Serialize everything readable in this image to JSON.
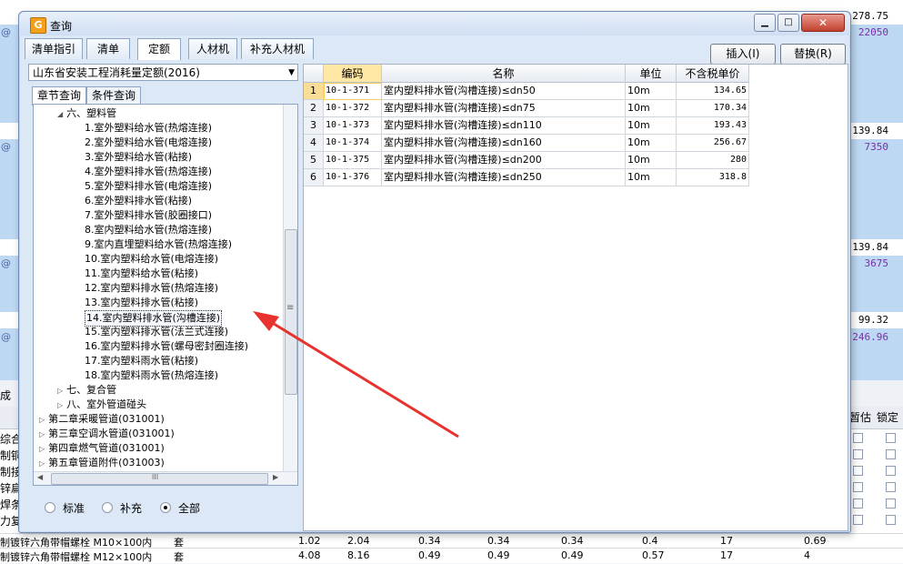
{
  "background": {
    "right_values": [
      {
        "text": "278.75",
        "color": "black"
      },
      {
        "text": "22050",
        "color": "purple"
      },
      {
        "text": "139.84",
        "color": "black"
      },
      {
        "text": "7350",
        "color": "purple"
      },
      {
        "text": "139.84",
        "color": "black"
      },
      {
        "text": "3675",
        "color": "purple"
      },
      {
        "text": "99.32",
        "color": "black"
      },
      {
        "text": "246.96",
        "color": "purple"
      }
    ],
    "at_symbol": "@",
    "lower_header_left": "成",
    "lower_col_headers": [
      "暂估",
      "锁定"
    ],
    "left_snippets": [
      "综合工",
      "制铜线",
      "制接线",
      "锌扁",
      "焊条",
      "力复"
    ],
    "bottom_rows": [
      {
        "name": "制镀锌六角带帽螺栓 M10×100内",
        "unit": "套",
        "v1": "1.02",
        "v2": "2.04",
        "v3": "0.34",
        "v4": "0.34",
        "v5": "0.34",
        "v6": "0.4",
        "v7": "17",
        "v8": "0.69"
      },
      {
        "name": "制镀锌六角带帽螺栓 M12×100内",
        "unit": "套",
        "v1": "4.08",
        "v2": "8.16",
        "v3": "0.49",
        "v4": "0.49",
        "v5": "0.49",
        "v6": "0.57",
        "v7": "17",
        "v8": "4"
      }
    ]
  },
  "dialog": {
    "title": "查询",
    "controls": {
      "minimize": "▁",
      "maximize": "□",
      "close": "✕"
    },
    "tabs": [
      "清单指引",
      "清单",
      "定额",
      "人材机",
      "补充人材机"
    ],
    "active_tab": "定额",
    "insert_label": "插入(I)",
    "replace_label": "替换(R)",
    "quota_lib": "山东省安装工程消耗量定额(2016)",
    "subtabs": [
      "章节查询",
      "条件查询"
    ],
    "tree": [
      {
        "label": "六、塑料管",
        "level": 2,
        "twisty": "◢"
      },
      {
        "label": "1.室外塑料给水管(热熔连接)",
        "level": 3
      },
      {
        "label": "2.室外塑料给水管(电熔连接)",
        "level": 3
      },
      {
        "label": "3.室外塑料给水管(粘接)",
        "level": 3
      },
      {
        "label": "4.室外塑料排水管(热熔连接)",
        "level": 3
      },
      {
        "label": "5.室外塑料排水管(电熔连接)",
        "level": 3
      },
      {
        "label": "6.室外塑料排水管(粘接)",
        "level": 3
      },
      {
        "label": "7.室外塑料排水管(胶圈接口)",
        "level": 3
      },
      {
        "label": "8.室内塑料给水管(热熔连接)",
        "level": 3
      },
      {
        "label": "9.室内直埋塑料给水管(热熔连接)",
        "level": 3
      },
      {
        "label": "10.室内塑料给水管(电熔连接)",
        "level": 3
      },
      {
        "label": "11.室内塑料给水管(粘接)",
        "level": 3
      },
      {
        "label": "12.室内塑料排水管(热熔连接)",
        "level": 3
      },
      {
        "label": "13.室内塑料排水管(粘接)",
        "level": 3
      },
      {
        "label": "14.室内塑料排水管(沟槽连接)",
        "level": 3,
        "selected": true
      },
      {
        "label": "15.室内塑料排水管(法兰式连接)",
        "level": 3
      },
      {
        "label": "16.室内塑料排水管(螺母密封圈连接)",
        "level": 3
      },
      {
        "label": "17.室内塑料雨水管(粘接)",
        "level": 3
      },
      {
        "label": "18.室内塑料雨水管(热熔连接)",
        "level": 3
      },
      {
        "label": "七、复合管",
        "level": 2,
        "twisty": "▷"
      },
      {
        "label": "八、室外管道碰头",
        "level": 2,
        "twisty": "▷"
      },
      {
        "label": "第二章采暖管道(031001)",
        "level": 1,
        "twisty": "▷"
      },
      {
        "label": "第三章空调水管道(031001)",
        "level": 1,
        "twisty": "▷"
      },
      {
        "label": "第四章燃气管道(031001)",
        "level": 1,
        "twisty": "▷"
      },
      {
        "label": "第五章管道附件(031003)",
        "level": 1,
        "twisty": "▷"
      }
    ],
    "scroll_grip": "≡",
    "hscroll_grip": "III",
    "hscroll_left": "◀",
    "hscroll_right": "▶",
    "radios": [
      {
        "label": "标准",
        "checked": false
      },
      {
        "label": "补充",
        "checked": false
      },
      {
        "label": "全部",
        "checked": true
      }
    ],
    "grid": {
      "headers": [
        "编码",
        "名称",
        "单位",
        "不含税单价"
      ],
      "rows": [
        {
          "n": "1",
          "code": "10-1-371",
          "name": "室内塑料排水管(沟槽连接)≤dn50",
          "unit": "10m",
          "price": "134.65"
        },
        {
          "n": "2",
          "code": "10-1-372",
          "name": "室内塑料排水管(沟槽连接)≤dn75",
          "unit": "10m",
          "price": "170.34"
        },
        {
          "n": "3",
          "code": "10-1-373",
          "name": "室内塑料排水管(沟槽连接)≤dn110",
          "unit": "10m",
          "price": "193.43"
        },
        {
          "n": "4",
          "code": "10-1-374",
          "name": "室内塑料排水管(沟槽连接)≤dn160",
          "unit": "10m",
          "price": "256.67"
        },
        {
          "n": "5",
          "code": "10-1-375",
          "name": "室内塑料排水管(沟槽连接)≤dn200",
          "unit": "10m",
          "price": "280"
        },
        {
          "n": "6",
          "code": "10-1-376",
          "name": "室内塑料排水管(沟槽连接)≤dn250",
          "unit": "10m",
          "price": "318.8"
        }
      ]
    }
  },
  "colors": {
    "annotation_arrow": "#e8322e",
    "selection_highlight": "#f9dd96",
    "purple_value": "#7a2fa8"
  }
}
